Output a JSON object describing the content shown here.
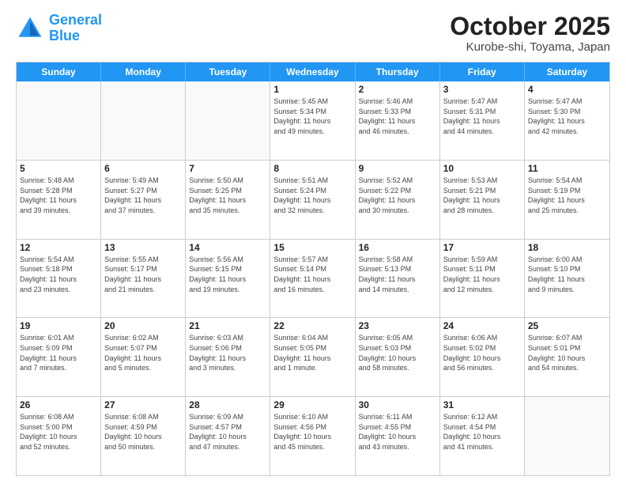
{
  "header": {
    "logo_line1": "General",
    "logo_line2": "Blue",
    "title": "October 2025",
    "subtitle": "Kurobe-shi, Toyama, Japan"
  },
  "weekdays": [
    "Sunday",
    "Monday",
    "Tuesday",
    "Wednesday",
    "Thursday",
    "Friday",
    "Saturday"
  ],
  "weeks": [
    [
      {
        "day": "",
        "info": ""
      },
      {
        "day": "",
        "info": ""
      },
      {
        "day": "",
        "info": ""
      },
      {
        "day": "1",
        "info": "Sunrise: 5:45 AM\nSunset: 5:34 PM\nDaylight: 11 hours\nand 49 minutes."
      },
      {
        "day": "2",
        "info": "Sunrise: 5:46 AM\nSunset: 5:33 PM\nDaylight: 11 hours\nand 46 minutes."
      },
      {
        "day": "3",
        "info": "Sunrise: 5:47 AM\nSunset: 5:31 PM\nDaylight: 11 hours\nand 44 minutes."
      },
      {
        "day": "4",
        "info": "Sunrise: 5:47 AM\nSunset: 5:30 PM\nDaylight: 11 hours\nand 42 minutes."
      }
    ],
    [
      {
        "day": "5",
        "info": "Sunrise: 5:48 AM\nSunset: 5:28 PM\nDaylight: 11 hours\nand 39 minutes."
      },
      {
        "day": "6",
        "info": "Sunrise: 5:49 AM\nSunset: 5:27 PM\nDaylight: 11 hours\nand 37 minutes."
      },
      {
        "day": "7",
        "info": "Sunrise: 5:50 AM\nSunset: 5:25 PM\nDaylight: 11 hours\nand 35 minutes."
      },
      {
        "day": "8",
        "info": "Sunrise: 5:51 AM\nSunset: 5:24 PM\nDaylight: 11 hours\nand 32 minutes."
      },
      {
        "day": "9",
        "info": "Sunrise: 5:52 AM\nSunset: 5:22 PM\nDaylight: 11 hours\nand 30 minutes."
      },
      {
        "day": "10",
        "info": "Sunrise: 5:53 AM\nSunset: 5:21 PM\nDaylight: 11 hours\nand 28 minutes."
      },
      {
        "day": "11",
        "info": "Sunrise: 5:54 AM\nSunset: 5:19 PM\nDaylight: 11 hours\nand 25 minutes."
      }
    ],
    [
      {
        "day": "12",
        "info": "Sunrise: 5:54 AM\nSunset: 5:18 PM\nDaylight: 11 hours\nand 23 minutes."
      },
      {
        "day": "13",
        "info": "Sunrise: 5:55 AM\nSunset: 5:17 PM\nDaylight: 11 hours\nand 21 minutes."
      },
      {
        "day": "14",
        "info": "Sunrise: 5:56 AM\nSunset: 5:15 PM\nDaylight: 11 hours\nand 19 minutes."
      },
      {
        "day": "15",
        "info": "Sunrise: 5:57 AM\nSunset: 5:14 PM\nDaylight: 11 hours\nand 16 minutes."
      },
      {
        "day": "16",
        "info": "Sunrise: 5:58 AM\nSunset: 5:13 PM\nDaylight: 11 hours\nand 14 minutes."
      },
      {
        "day": "17",
        "info": "Sunrise: 5:59 AM\nSunset: 5:11 PM\nDaylight: 11 hours\nand 12 minutes."
      },
      {
        "day": "18",
        "info": "Sunrise: 6:00 AM\nSunset: 5:10 PM\nDaylight: 11 hours\nand 9 minutes."
      }
    ],
    [
      {
        "day": "19",
        "info": "Sunrise: 6:01 AM\nSunset: 5:09 PM\nDaylight: 11 hours\nand 7 minutes."
      },
      {
        "day": "20",
        "info": "Sunrise: 6:02 AM\nSunset: 5:07 PM\nDaylight: 11 hours\nand 5 minutes."
      },
      {
        "day": "21",
        "info": "Sunrise: 6:03 AM\nSunset: 5:06 PM\nDaylight: 11 hours\nand 3 minutes."
      },
      {
        "day": "22",
        "info": "Sunrise: 6:04 AM\nSunset: 5:05 PM\nDaylight: 11 hours\nand 1 minute."
      },
      {
        "day": "23",
        "info": "Sunrise: 6:05 AM\nSunset: 5:03 PM\nDaylight: 10 hours\nand 58 minutes."
      },
      {
        "day": "24",
        "info": "Sunrise: 6:06 AM\nSunset: 5:02 PM\nDaylight: 10 hours\nand 56 minutes."
      },
      {
        "day": "25",
        "info": "Sunrise: 6:07 AM\nSunset: 5:01 PM\nDaylight: 10 hours\nand 54 minutes."
      }
    ],
    [
      {
        "day": "26",
        "info": "Sunrise: 6:08 AM\nSunset: 5:00 PM\nDaylight: 10 hours\nand 52 minutes."
      },
      {
        "day": "27",
        "info": "Sunrise: 6:08 AM\nSunset: 4:59 PM\nDaylight: 10 hours\nand 50 minutes."
      },
      {
        "day": "28",
        "info": "Sunrise: 6:09 AM\nSunset: 4:57 PM\nDaylight: 10 hours\nand 47 minutes."
      },
      {
        "day": "29",
        "info": "Sunrise: 6:10 AM\nSunset: 4:56 PM\nDaylight: 10 hours\nand 45 minutes."
      },
      {
        "day": "30",
        "info": "Sunrise: 6:11 AM\nSunset: 4:55 PM\nDaylight: 10 hours\nand 43 minutes."
      },
      {
        "day": "31",
        "info": "Sunrise: 6:12 AM\nSunset: 4:54 PM\nDaylight: 10 hours\nand 41 minutes."
      },
      {
        "day": "",
        "info": ""
      }
    ]
  ]
}
